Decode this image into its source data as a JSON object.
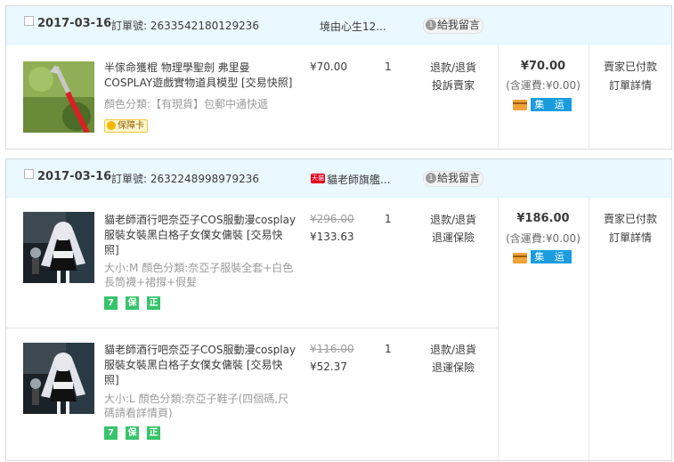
{
  "orders": [
    {
      "date": "2017-03-16",
      "order_no_label": "訂單號:",
      "order_no": "2633542180129236",
      "shop": "境由心生12...",
      "message_btn": "給我留言",
      "message_count": "1",
      "items": [
        {
          "thumb": "red-pole-prop-image",
          "name": "半傢命獲棍 物理學聖劍 弗里曼 COSPLAY遊戲實物道具模型 [交易快照]",
          "attrs": "顏色分類:【有現貨】包郵中通快遞",
          "price_orig": "",
          "price": "¥70.00",
          "qty": "1",
          "actions": [
            "退款/退貨",
            "投訴賣家"
          ],
          "badges": [
            "保障卡"
          ]
        }
      ],
      "total": "¥70.00",
      "shipping": "(含運費:¥0.00)",
      "ship_tag": "集 运",
      "status": [
        "賣家已付款",
        "訂單詳情"
      ]
    },
    {
      "date": "2017-03-16",
      "order_no_label": "訂單號:",
      "order_no": "2632248998979236",
      "shop": "貓老師旗艦...",
      "shop_badge": "天貓",
      "message_btn": "給我留言",
      "message_count": "1",
      "items": [
        {
          "thumb": "maid-cosplay-image",
          "name": "貓老師酒行吧奈亞子COS服動漫cosplay服裝女裝黑白格子女僕女傭裝 [交易快照]",
          "attrs": "大小:M  顏色分類:奈亞子服裝全套+白色長筒襪+裙撐+假髮",
          "price_orig": "¥296.00",
          "price": "¥133.63",
          "qty": "1",
          "actions": [
            "退款/退貨",
            "退運保險"
          ],
          "badges": [
            "7",
            "保",
            "正"
          ]
        },
        {
          "thumb": "maid-cosplay-image",
          "name": "貓老師酒行吧奈亞子COS服動漫cosplay服裝女裝黑白格子女僕女傭裝 [交易快照]",
          "attrs": "大小:L  顏色分類:奈亞子鞋子(四個碼,尺碼請看詳情頁)",
          "price_orig": "¥116.00",
          "price": "¥52.37",
          "qty": "1",
          "actions": [
            "退款/退貨",
            "退運保險"
          ],
          "badges": [
            "7",
            "保",
            "正"
          ]
        }
      ],
      "total": "¥186.00",
      "shipping": "(含運費:¥0.00)",
      "ship_tag": "集 运",
      "status": [
        "賣家已付款",
        "訂單詳情"
      ]
    }
  ]
}
